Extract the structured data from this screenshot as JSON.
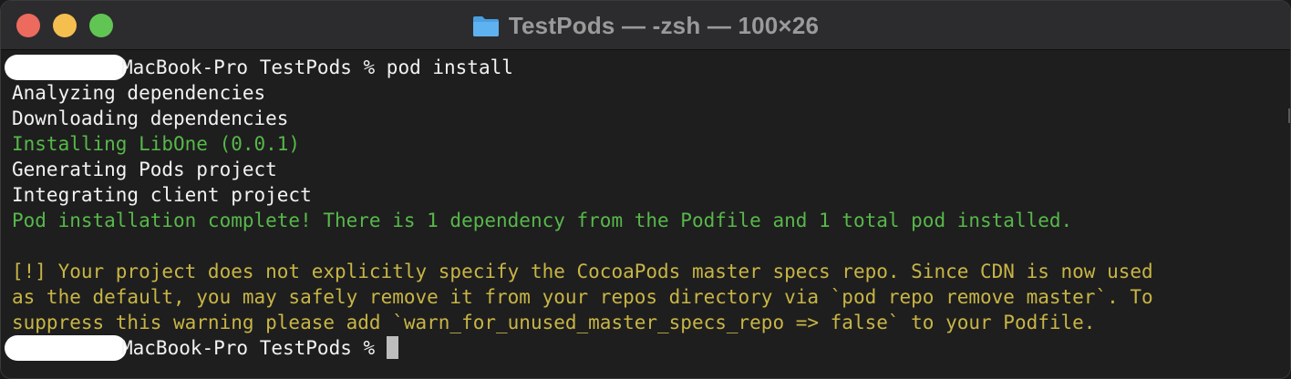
{
  "window": {
    "title": "TestPods — -zsh — 100×26",
    "title_icon": "folder-icon"
  },
  "colors": {
    "background": "#1e1e1e",
    "titlebar": "#2c2c2e",
    "text": "#f2f2f2",
    "success_green": "#57b84a",
    "warning_yellow": "#c8b545"
  },
  "terminal": {
    "prompt1": {
      "text": "MacBook-Pro TestPods % ",
      "command": "pod install"
    },
    "output": {
      "l1": "Analyzing dependencies",
      "l2": "Downloading dependencies",
      "l3": "Installing LibOne (0.0.1)",
      "l4": "Generating Pods project",
      "l5": "Integrating client project",
      "l6": "Pod installation complete! There is 1 dependency from the Podfile and 1 total pod installed.",
      "warn1": "[!] Your project does not explicitly specify the CocoaPods master specs repo. Since CDN is now used",
      "warn2": "as the default, you may safely remove it from your repos directory via `pod repo remove master`. To",
      "warn3": "suppress this warning please add `warn_for_unused_master_specs_repo => false` to your Podfile."
    },
    "prompt2": {
      "text": "MacBook-Pro TestPods % "
    }
  }
}
